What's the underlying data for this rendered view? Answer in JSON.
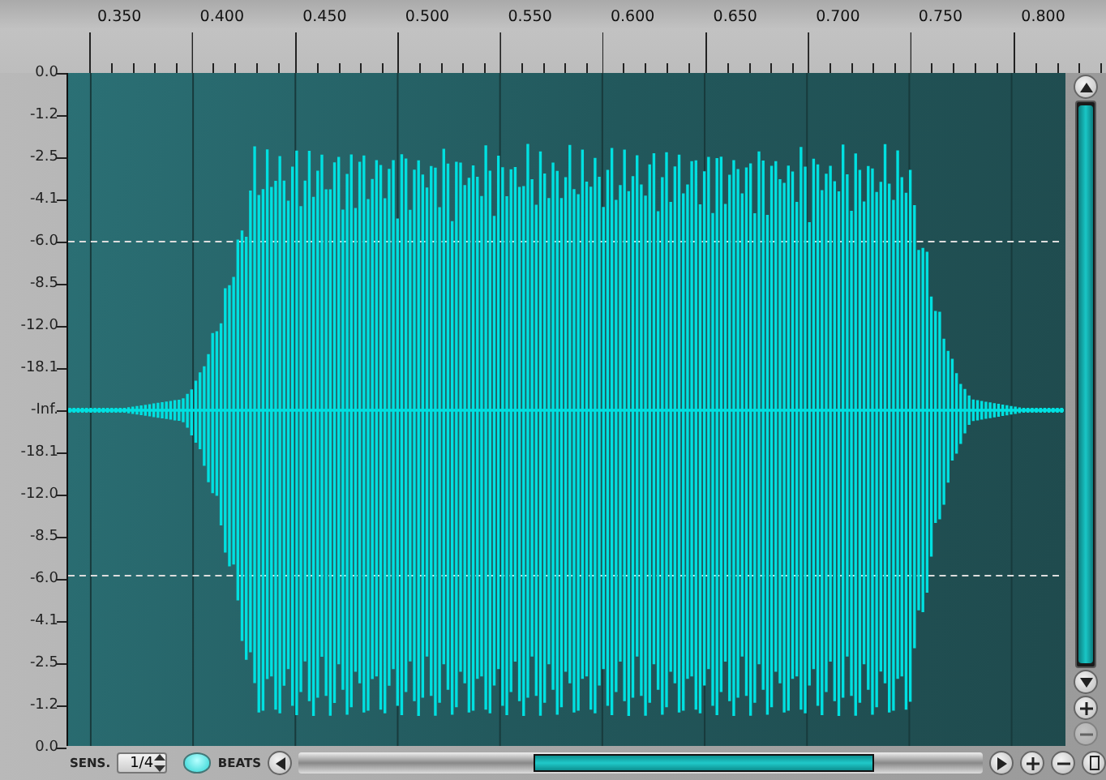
{
  "time_ruler": {
    "labels": [
      "0.350",
      "0.400",
      "0.450",
      "0.500",
      "0.550",
      "0.600",
      "0.650",
      "0.700",
      "0.750",
      "0.800"
    ]
  },
  "level_axis": {
    "labels": [
      "0.0",
      "-1.2",
      "-2.5",
      "-4.1",
      "-6.0",
      "-8.5",
      "-12.0",
      "-18.1",
      "-Inf.",
      "-18.1",
      "-12.0",
      "-8.5",
      "-6.0",
      "-4.1",
      "-2.5",
      "-1.2",
      "0.0"
    ]
  },
  "bottom_bar": {
    "sens_label": "SENS.",
    "sens_value": "1/4",
    "beats_toggle": {
      "on": true
    },
    "beats_label": "BEATS"
  }
}
